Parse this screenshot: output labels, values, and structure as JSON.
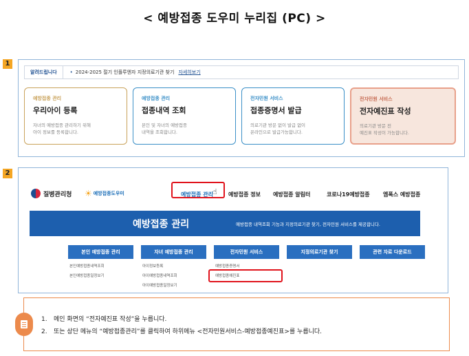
{
  "title": "< 예방접종 도우미 누리집 (PC) >",
  "steps": [
    "1",
    "2"
  ],
  "panel1": {
    "notice": {
      "tag": "알려드립니다",
      "text": "2024-2025 절기 인플루엔자 지정의료기관 찾기",
      "link": "자세히보기"
    },
    "cards": [
      {
        "category": "예방접종 관리",
        "title": "우리아이 등록",
        "desc": "자녀의 예방접종 관리하기 위해\n아이 정보를 등록합니다.",
        "color": "#c9a25a"
      },
      {
        "category": "예방접종 관리",
        "title": "접종내역 조회",
        "desc": "본인 및 자녀의 예방접종\n내역을 조회합니다.",
        "color": "#3a8fc7"
      },
      {
        "category": "전자민원 서비스",
        "title": "접종증명서 발급",
        "desc": "의료기관 방문 없이 발급 없이\n온라인으로 발급가능합니다.",
        "color": "#3a8fc7"
      },
      {
        "category": "전자민원 서비스",
        "title": "전자예진표 작성",
        "desc": "의료기관 방문 전\n예진표 작성이 가능합니다.",
        "color": "#e8a08a"
      }
    ]
  },
  "panel2": {
    "logo1": "질병관리청",
    "logo2": "예방접종도우미",
    "menu": [
      "예방접종 관리",
      "예방접종 정보",
      "예방접종 알림터",
      "코로나19예방접종",
      "엠폭스 예방접종"
    ],
    "banner": {
      "title": "예방접종 관리",
      "subtitle": "예방접종 내역조회 기능과 지정의료기관 찾기, 전자민원 서비스를 제공합니다."
    },
    "submenu": [
      {
        "head": "본인 예방접종 관리",
        "items": [
          "본인예방접종내역조회",
          "본인예방접종일정보기"
        ]
      },
      {
        "head": "자녀 예방접종 관리",
        "items": [
          "아이정보등록",
          "아이예방접종내역조회",
          "아이예방접종일정보기"
        ]
      },
      {
        "head": "전자민원 서비스",
        "items": [
          "예방접종증명서",
          "예방접종예진표"
        ]
      },
      {
        "head": "지정의료기관 찾기",
        "items": []
      },
      {
        "head": "관련 자료 다운로드",
        "items": []
      }
    ]
  },
  "instructions": [
    {
      "num": "1.",
      "text": "메인 화면의 “전자예진표 작성”을 누릅니다."
    },
    {
      "num": "2.",
      "text": "또는 상단 메뉴의 “예방접종관리”를 클릭하여 하위메뉴 <전자민원서비스-예방접종예진표>를 누릅니다."
    }
  ],
  "colors": {
    "accent": "#1d5fae",
    "highlight": "#e0121b",
    "badge": "#f5a623",
    "instruction_border": "#ec8a4c"
  }
}
